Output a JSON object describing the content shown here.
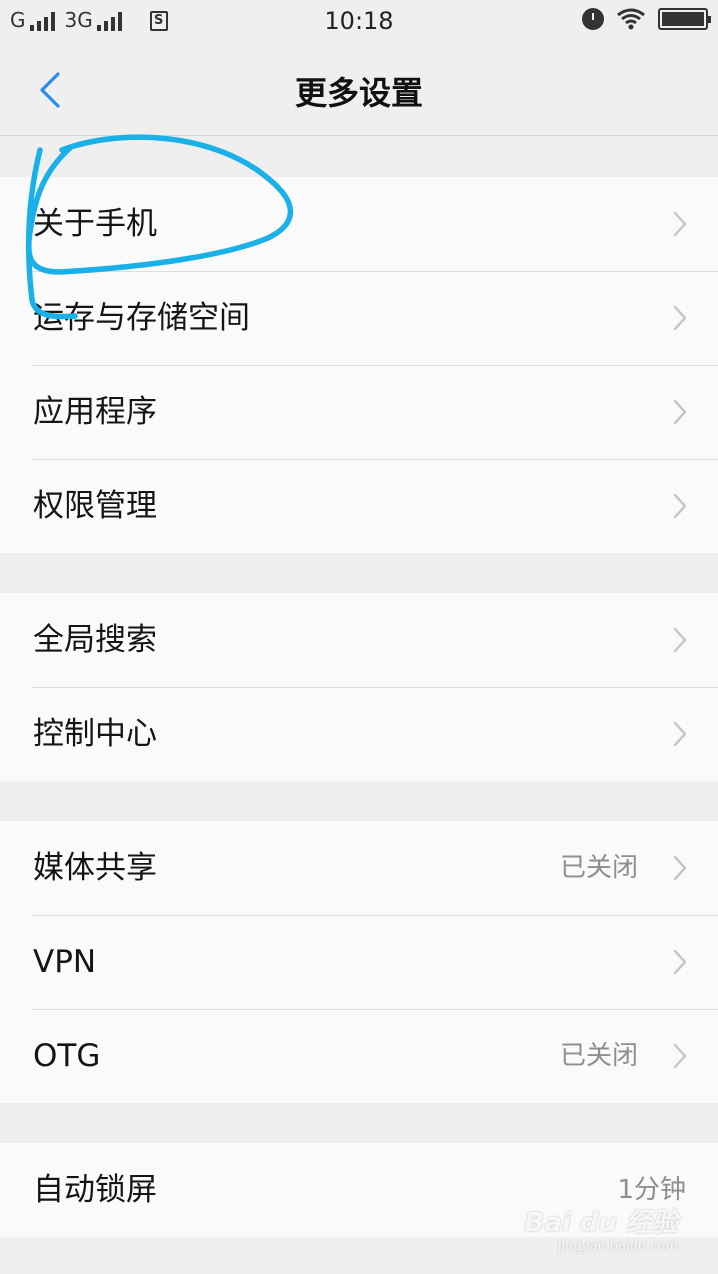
{
  "status_bar": {
    "carrier1": "G",
    "carrier2": "3G",
    "sim_label": "S",
    "time": "10:18"
  },
  "header": {
    "title": "更多设置",
    "back_icon": "chevron-left-icon"
  },
  "groups": [
    {
      "items": [
        {
          "label": "关于手机",
          "value": ""
        },
        {
          "label": "运存与存储空间",
          "value": ""
        },
        {
          "label": "应用程序",
          "value": ""
        },
        {
          "label": "权限管理",
          "value": ""
        }
      ]
    },
    {
      "items": [
        {
          "label": "全局搜索",
          "value": ""
        },
        {
          "label": "控制中心",
          "value": ""
        }
      ]
    },
    {
      "items": [
        {
          "label": "媒体共享",
          "value": "已关闭"
        },
        {
          "label": "VPN",
          "value": ""
        },
        {
          "label": "OTG",
          "value": "已关闭"
        }
      ]
    },
    {
      "items": [
        {
          "label": "自动锁屏",
          "value": "1分钟"
        }
      ]
    }
  ],
  "watermark": {
    "brand": "Bai du 经验",
    "url": "jingyan.baidu.com"
  },
  "colors": {
    "accent": "#2a8cf0",
    "annotation": "#1ab0e8",
    "background": "#efefef",
    "card": "#fafafa",
    "secondary_text": "#8e8e8e"
  }
}
